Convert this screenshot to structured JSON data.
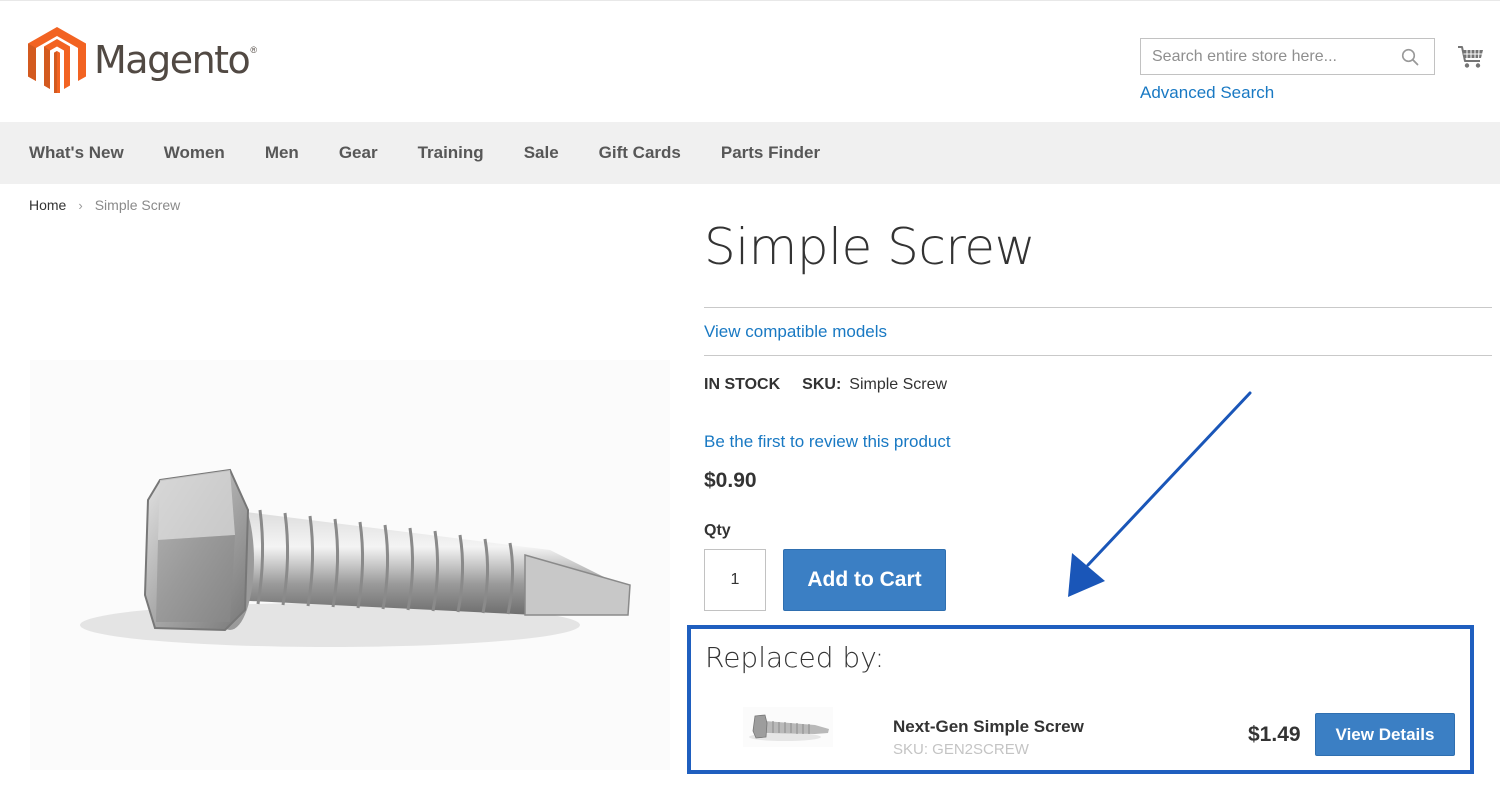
{
  "header": {
    "logo_text": "Magento",
    "logo_reg": "®",
    "search": {
      "placeholder": "Search entire store here...",
      "value": ""
    },
    "advanced_search_label": "Advanced Search"
  },
  "nav": {
    "items": [
      {
        "label": "What's New"
      },
      {
        "label": "Women"
      },
      {
        "label": "Men"
      },
      {
        "label": "Gear"
      },
      {
        "label": "Training"
      },
      {
        "label": "Sale"
      },
      {
        "label": "Gift Cards"
      },
      {
        "label": "Parts Finder"
      }
    ]
  },
  "breadcrumb": {
    "home": "Home",
    "separator": "›",
    "current": "Simple Screw"
  },
  "product": {
    "title": "Simple Screw",
    "compatible_link": "View compatible models",
    "stock": "IN STOCK",
    "sku_label": "SKU:",
    "sku": "Simple Screw",
    "review_link": "Be the first to review this product",
    "price": "$0.90",
    "qty_label": "Qty",
    "qty_value": "1",
    "add_to_cart_label": "Add to Cart"
  },
  "replaced": {
    "title": "Replaced by:",
    "item": {
      "name": "Next-Gen Simple Screw",
      "sku": "SKU: GEN2SCREW",
      "price": "$1.49",
      "button_label": "View Details"
    }
  },
  "colors": {
    "link": "#1979c3",
    "button": "#3b7fc4",
    "highlight_border": "#1f5fbf",
    "logo_orange": "#f26322",
    "nav_bg": "#f0f0f0"
  }
}
